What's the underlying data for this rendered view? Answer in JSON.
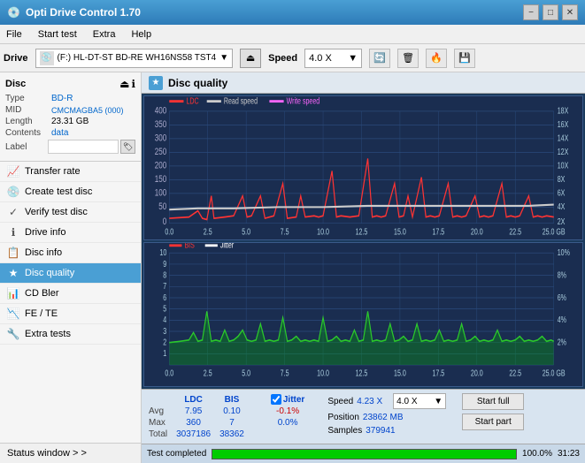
{
  "app": {
    "title": "Opti Drive Control 1.70",
    "icon": "💿"
  },
  "title_controls": {
    "minimize": "−",
    "maximize": "□",
    "close": "✕"
  },
  "menu": {
    "items": [
      "File",
      "Start test",
      "Extra",
      "Help"
    ]
  },
  "toolbar": {
    "drive_label": "Drive",
    "drive_value": "(F:) HL-DT-ST BD-RE  WH16NS58 TST4",
    "speed_label": "Speed",
    "speed_value": "4.0 X"
  },
  "disc": {
    "section_title": "Disc",
    "type_label": "Type",
    "type_value": "BD-R",
    "mid_label": "MID",
    "mid_value": "CMCMAGBA5 (000)",
    "length_label": "Length",
    "length_value": "23.31 GB",
    "contents_label": "Contents",
    "contents_value": "data",
    "label_label": "Label",
    "label_value": ""
  },
  "nav": {
    "items": [
      {
        "id": "transfer-rate",
        "label": "Transfer rate",
        "icon": "📈"
      },
      {
        "id": "create-test-disc",
        "label": "Create test disc",
        "icon": "💿"
      },
      {
        "id": "verify-test-disc",
        "label": "Verify test disc",
        "icon": "✓"
      },
      {
        "id": "drive-info",
        "label": "Drive info",
        "icon": "ℹ"
      },
      {
        "id": "disc-info",
        "label": "Disc info",
        "icon": "📋"
      },
      {
        "id": "disc-quality",
        "label": "Disc quality",
        "icon": "★",
        "active": true
      },
      {
        "id": "cd-bler",
        "label": "CD Bler",
        "icon": "📊"
      },
      {
        "id": "fe-te",
        "label": "FE / TE",
        "icon": "📉"
      },
      {
        "id": "extra-tests",
        "label": "Extra tests",
        "icon": "🔧"
      }
    ],
    "status_window": "Status window > >"
  },
  "chart": {
    "title": "Disc quality",
    "top_chart": {
      "legend": [
        {
          "label": "LDC",
          "color": "#ff4444"
        },
        {
          "label": "Read speed",
          "color": "#ffffff"
        },
        {
          "label": "Write speed",
          "color": "#ff66ff"
        }
      ],
      "y_max": 400,
      "y_labels": [
        "400",
        "350",
        "300",
        "250",
        "200",
        "150",
        "100",
        "50",
        "0"
      ],
      "right_labels": [
        "18X",
        "16X",
        "14X",
        "12X",
        "10X",
        "8X",
        "6X",
        "4X",
        "2X"
      ],
      "x_labels": [
        "0.0",
        "2.5",
        "5.0",
        "7.5",
        "10.0",
        "12.5",
        "15.0",
        "17.5",
        "20.0",
        "22.5",
        "25.0 GB"
      ]
    },
    "bottom_chart": {
      "legend": [
        {
          "label": "BIS",
          "color": "#ff4444"
        },
        {
          "label": "Jitter",
          "color": "#ffffff"
        }
      ],
      "y_max": 10,
      "y_labels": [
        "10",
        "9",
        "8",
        "7",
        "6",
        "5",
        "4",
        "3",
        "2",
        "1"
      ],
      "right_labels": [
        "10%",
        "8%",
        "6%",
        "4%",
        "2%"
      ],
      "x_labels": [
        "0.0",
        "2.5",
        "5.0",
        "7.5",
        "10.0",
        "12.5",
        "15.0",
        "17.5",
        "20.0",
        "22.5",
        "25.0 GB"
      ]
    }
  },
  "stats": {
    "columns": [
      "",
      "LDC",
      "BIS",
      "",
      "Jitter",
      "Speed",
      ""
    ],
    "avg_label": "Avg",
    "avg_ldc": "7.95",
    "avg_bis": "0.10",
    "avg_jitter": "-0.1%",
    "max_label": "Max",
    "max_ldc": "360",
    "max_bis": "7",
    "max_jitter": "0.0%",
    "total_label": "Total",
    "total_ldc": "3037186",
    "total_bis": "38362",
    "speed_label": "Speed",
    "speed_value": "4.23 X",
    "speed_select": "4.0 X",
    "position_label": "Position",
    "position_value": "23862 MB",
    "samples_label": "Samples",
    "samples_value": "379941",
    "jitter_checked": true,
    "btn_start_full": "Start full",
    "btn_start_part": "Start part"
  },
  "progress": {
    "value": 100,
    "text": "100.0%",
    "time": "31:23",
    "status": "Test completed"
  },
  "colors": {
    "accent_blue": "#4a9fd4",
    "sidebar_active": "#4a9fd4",
    "chart_bg": "#1a2a4a",
    "ldc_color": "#ff3333",
    "read_speed_color": "#cccccc",
    "bis_color": "#33ff33",
    "jitter_color": "#ffffff"
  }
}
